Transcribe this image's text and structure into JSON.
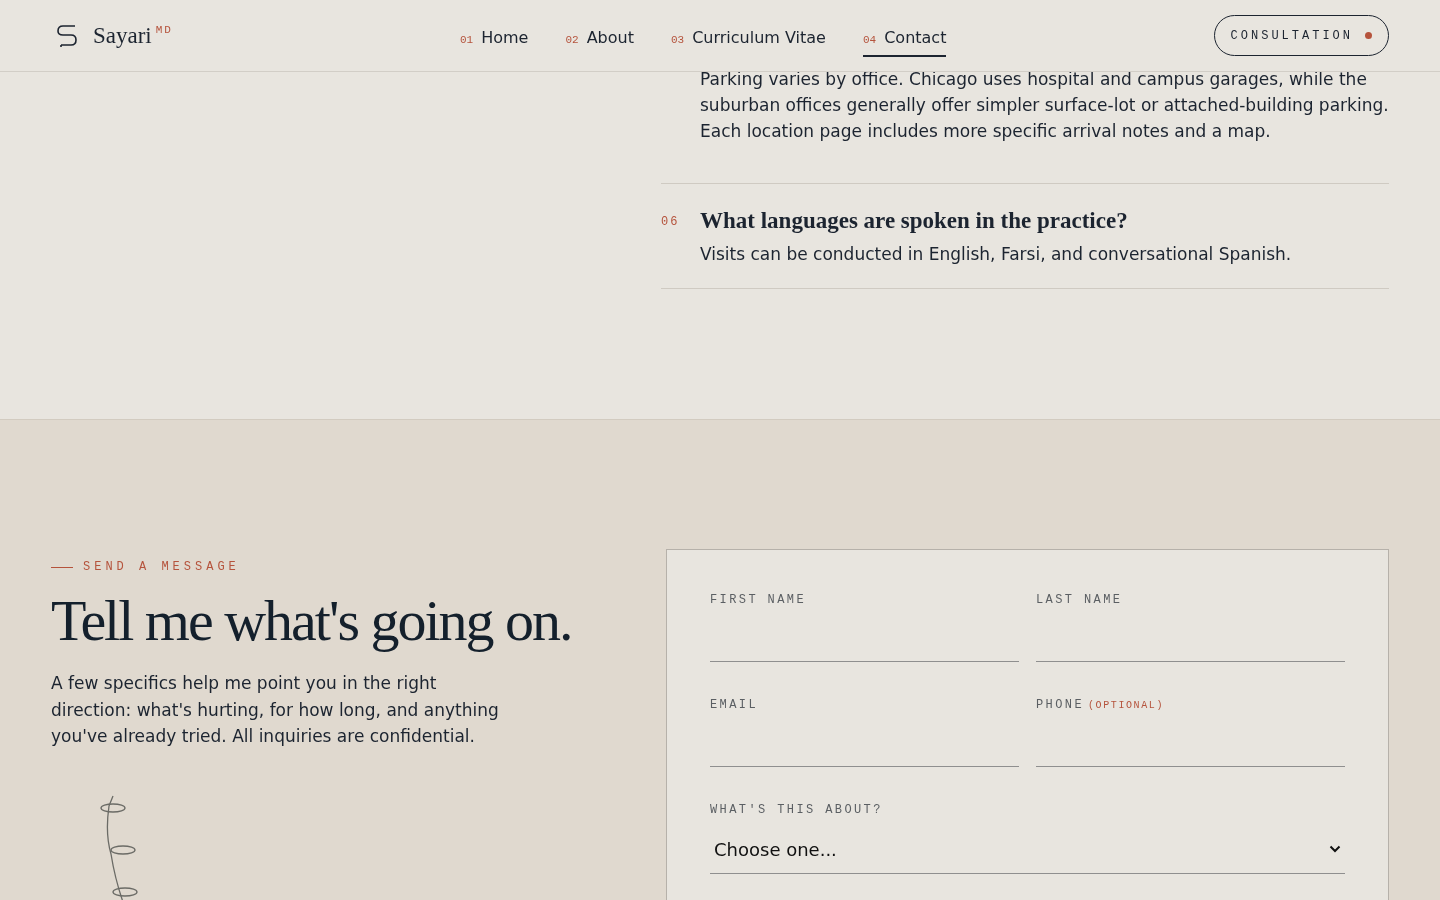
{
  "header": {
    "logo": {
      "name": "Sayari",
      "superscript": "MD"
    },
    "nav": [
      {
        "number": "01",
        "label": "Home",
        "selected": false
      },
      {
        "number": "02",
        "label": "About",
        "selected": false
      },
      {
        "number": "03",
        "label": "Curriculum Vitae",
        "selected": false
      },
      {
        "number": "04",
        "label": "Contact",
        "selected": true
      }
    ],
    "cta": "CONSULTATION"
  },
  "faq": [
    {
      "answer": "Parking varies by office. Chicago uses hospital and campus garages, while the suburban offices generally offer simpler surface-lot or attached-building parking. Each location page includes more specific arrival notes and a map."
    },
    {
      "number": "06",
      "question": "What languages are spoken in the practice?",
      "answer": "Visits can be conducted in English, Farsi, and conversational Spanish."
    }
  ],
  "contact": {
    "eyebrow": "SEND A MESSAGE",
    "heading": "Tell me what's going on.",
    "intro": "A few specifics help me point you in the right direction: what's hurting, for how long, and anything you've already tried. All inquiries are confidential.",
    "form": {
      "rows": [
        [
          {
            "kind": "text",
            "label": "FIRST NAME"
          },
          {
            "kind": "text",
            "label": "LAST NAME"
          }
        ],
        [
          {
            "kind": "text",
            "label": "EMAIL"
          },
          {
            "kind": "text",
            "label": "PHONE",
            "note": "(OPTIONAL)"
          }
        ],
        [
          {
            "kind": "select",
            "label": "WHAT'S THIS ABOUT?",
            "value": "Choose one..."
          }
        ]
      ]
    }
  }
}
